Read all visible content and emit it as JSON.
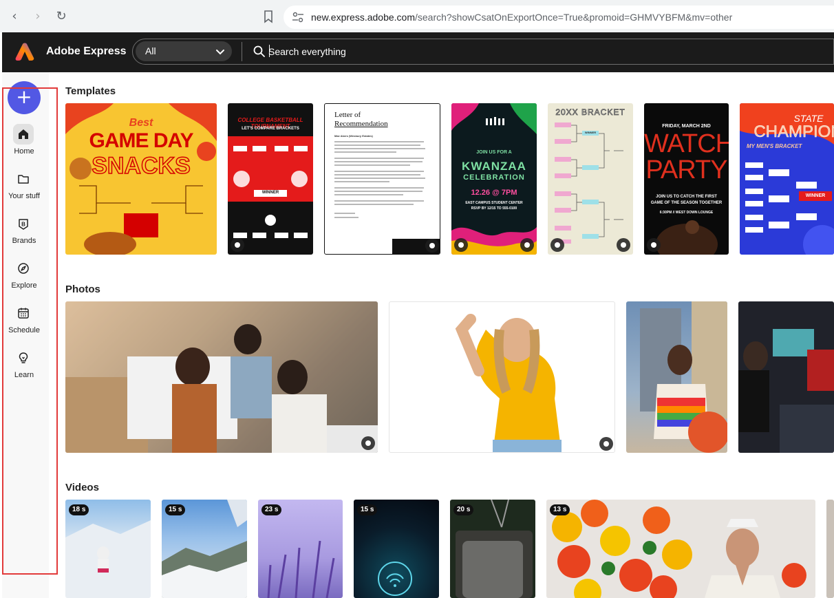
{
  "browser": {
    "url_host": "new.express.adobe.com",
    "url_path": "/search?showCsatOnExportOnce=True&promoid=GHMVYBFM&mv=other"
  },
  "header": {
    "app_name": "Adobe Express",
    "filter_value": "All",
    "search_placeholder": "Search everything"
  },
  "sidebar": {
    "items": [
      {
        "label": "Home",
        "icon": "home-icon"
      },
      {
        "label": "Your stuff",
        "icon": "folder-icon"
      },
      {
        "label": "Brands",
        "icon": "brand-icon"
      },
      {
        "label": "Explore",
        "icon": "compass-icon"
      },
      {
        "label": "Schedule",
        "icon": "calendar-icon"
      },
      {
        "label": "Learn",
        "icon": "lightbulb-icon"
      }
    ]
  },
  "sections": {
    "templates": "Templates",
    "photos": "Photos",
    "videos": "Videos"
  },
  "templates": [
    {
      "line1": "Best",
      "line2": "GAME DAY",
      "line3": "SNACKS"
    },
    {
      "line1": "COLLEGE BASKETBALL TOURNAMENT",
      "line2": "LET'S COMPARE BRACKETS",
      "line3": "WINNER"
    },
    {
      "line1": "Letter of",
      "line2": "Recommendation",
      "line3": "Mae Akers (Wesbury Estates)"
    },
    {
      "line1": "JOIN US FOR A",
      "line2": "KWANZAA",
      "line3": "CELEBRATION",
      "line4": "12.26 @ 7PM",
      "line5": "EAST CAMPUS STUDENT CENTER",
      "line6": "RSVP BY 12/15 TO 555-0100"
    },
    {
      "line1": "20XX BRACKET",
      "line2": "WINNER"
    },
    {
      "line1": "FRIDAY, MARCH 2ND",
      "line2": "WATCH",
      "line3": "PARTY",
      "line4": "JOIN US TO CATCH THE FIRST GAME OF THE SEASON TOGETHER",
      "line5": "6:30PM // WEST DOWN LOUNGE"
    },
    {
      "line1": "STATE",
      "line2": "CHAMPION",
      "line3": "MY MEN'S BRACKET",
      "line4": "WINNER"
    }
  ],
  "videos": [
    {
      "duration": "18 s"
    },
    {
      "duration": "15 s"
    },
    {
      "duration": "23 s"
    },
    {
      "duration": "15 s"
    },
    {
      "duration": "20 s"
    },
    {
      "duration": "13 s"
    }
  ],
  "colors": {
    "accent": "#5258e4",
    "header_bg": "#1b1b1b",
    "highlight": "#e23a3a"
  }
}
